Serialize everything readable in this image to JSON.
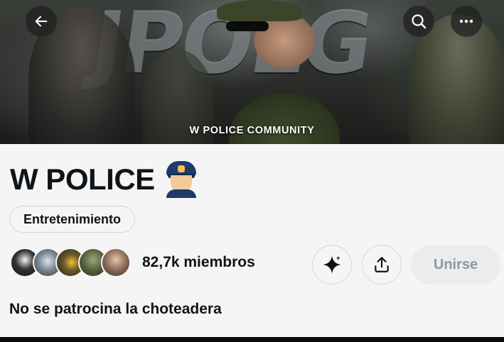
{
  "banner": {
    "title": "W POLICE COMMUNITY",
    "back_icon": "arrow-left-icon",
    "search_icon": "search-icon",
    "more_icon": "more-horizontal-icon"
  },
  "community": {
    "name": "W POLICE",
    "emoji": "police-officer-emoji",
    "category": "Entretenimiento",
    "members": "82,7k miembros",
    "description": "No se patrocina la choteadera"
  },
  "actions": {
    "grok_icon": "sparkle-icon",
    "share_icon": "share-icon",
    "join_label": "Unirse"
  },
  "colors": {
    "text": "#0f1419",
    "border": "#cfd9de",
    "join_bg": "#ececec",
    "join_text": "#8b98a5",
    "background": "#f5f5f5"
  }
}
